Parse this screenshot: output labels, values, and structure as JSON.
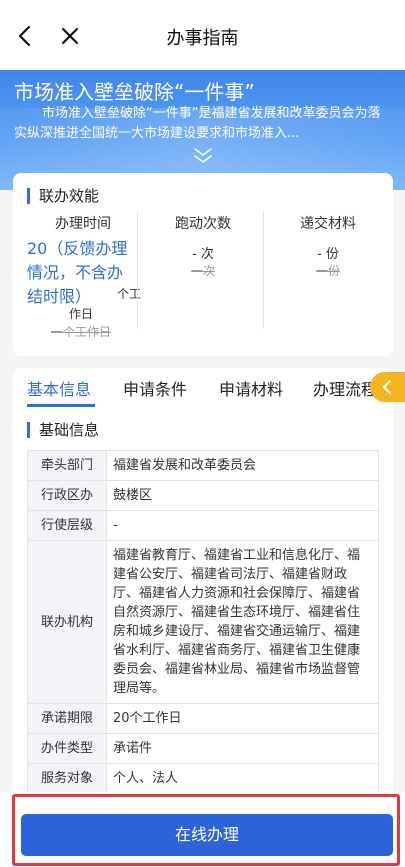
{
  "header": {
    "title": "办事指南"
  },
  "hero": {
    "title": "市场准入壁垒破除“一件事”",
    "description": "市场准入壁垒破除“一件事”是福建省发展和改革委员会为落实纵深推进全国统一大市场建设要求和市场准入..."
  },
  "efficiency": {
    "section_title": "联办效能",
    "columns": [
      {
        "label": "办理时间",
        "value": "20（反馈办理情况，不含办结时限）",
        "unit_a": "个工",
        "unit_b": "作日",
        "old": "一个工作日"
      },
      {
        "label": "跑动次数",
        "value": "-",
        "unit": "次",
        "old": "一次"
      },
      {
        "label": "递交材料",
        "value": "-",
        "unit": "份",
        "old": "一份"
      }
    ]
  },
  "tabs": [
    "基本信息",
    "申请条件",
    "申请材料",
    "办理流程"
  ],
  "basic": {
    "section_title": "基础信息",
    "rows": [
      {
        "key": "牵头部门",
        "value": "福建省发展和改革委员会"
      },
      {
        "key": "行政区办",
        "value": "鼓楼区"
      },
      {
        "key": "行使层级",
        "value": "-"
      },
      {
        "key": "联办机构",
        "value": "福建省教育厅、福建省工业和信息化厅、福建省公安厅、福建省司法厅、福建省财政厅、福建省人力资源和社会保障厅、福建省自然资源厅、福建省生态环境厅、福建省住房和城乡建设厅、福建省交通运输厅、福建省水利厅、福建省商务厅、福建省卫生健康委员会、福建省林业局、福建省市场监督管理局等。"
      },
      {
        "key": "承诺期限",
        "value": "20个工作日"
      },
      {
        "key": "办件类型",
        "value": "承诺件"
      },
      {
        "key": "服务对象",
        "value": "个人、法人"
      }
    ]
  },
  "actions": {
    "online_button": "在线办理"
  },
  "colors": {
    "primary": "#2e6fd9",
    "button": "#2d63d8",
    "highlight_border": "#e0383e",
    "arrow": "#f5b523"
  }
}
